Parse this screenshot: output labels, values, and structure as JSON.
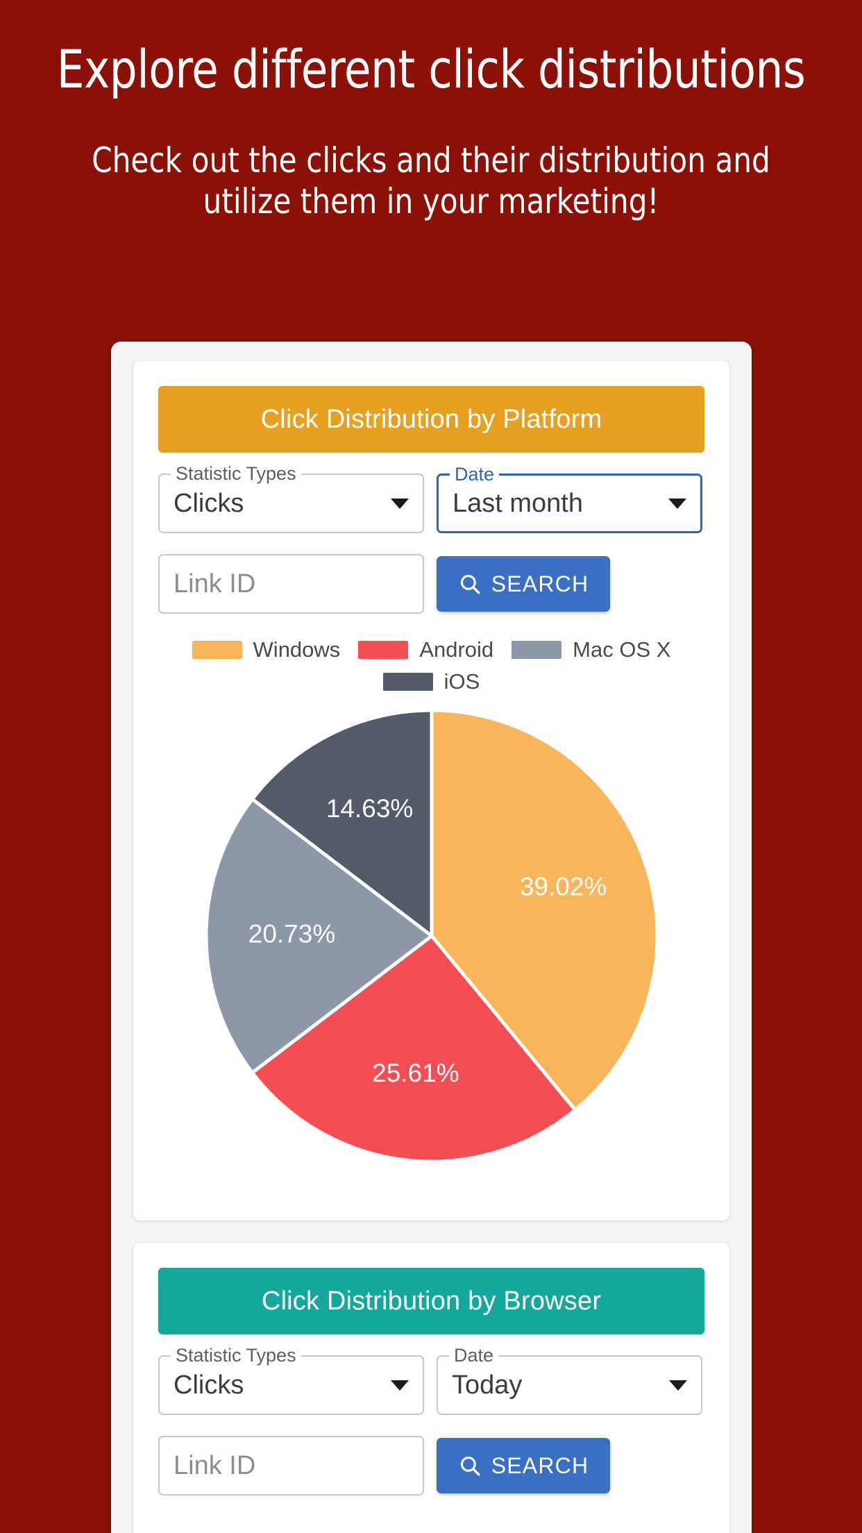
{
  "hero": {
    "title": "Explore different click distributions",
    "subtitle": "Check out the clicks and their distribution and utilize them in your marketing!"
  },
  "colors": {
    "background": "#8B1108",
    "platform_header": "#E8A021",
    "browser_header": "#14A79B",
    "search_button": "#3B6FC4",
    "focus_blue": "#2F63BE",
    "windows": "#F8B55A",
    "android": "#F44E54",
    "macosx": "#8E97A8",
    "ios": "#545B68"
  },
  "platform_card": {
    "header": "Click Distribution by Platform",
    "stat_label": "Statistic Types",
    "stat_value": "Clicks",
    "date_label": "Date",
    "date_value": "Last month",
    "linkid_placeholder": "Link ID",
    "linkid_value": "",
    "search_label": "SEARCH"
  },
  "browser_card": {
    "header": "Click Distribution by Browser",
    "stat_label": "Statistic Types",
    "stat_value": "Clicks",
    "date_label": "Date",
    "date_value": "Today",
    "linkid_placeholder": "Link ID",
    "linkid_value": "",
    "search_label": "SEARCH"
  },
  "chart_data": {
    "type": "pie",
    "title": "Click Distribution by Platform",
    "legend_position": "top",
    "labels": [
      "Windows",
      "Android",
      "Mac OS X",
      "iOS"
    ],
    "values": [
      39.02,
      25.61,
      20.73,
      14.63
    ],
    "value_labels": [
      "39.02%",
      "25.61%",
      "20.73%",
      "14.63%"
    ],
    "colors": [
      "#F8B55A",
      "#F44E54",
      "#8E97A8",
      "#545B68"
    ],
    "units": "percent",
    "start_angle_deg": 0,
    "direction": "clockwise"
  }
}
